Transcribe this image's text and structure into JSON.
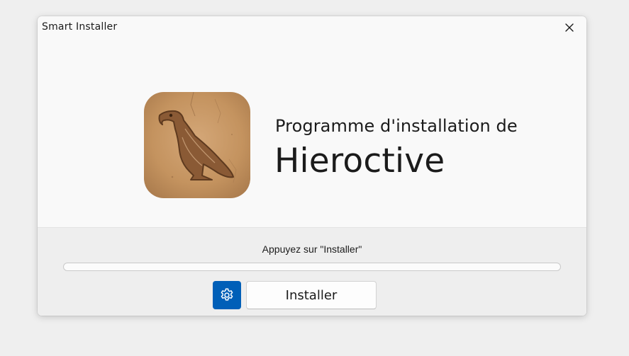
{
  "window": {
    "title": "Smart Installer"
  },
  "hero": {
    "subtitle": "Programme d'installation de",
    "app_name": "Hieroctive",
    "logo_icon": "falcon-hieroglyph-icon"
  },
  "footer": {
    "status": "Appuyez sur \"Installer\"",
    "progress_percent": 0,
    "settings_icon": "gear-icon",
    "install_label": "Installer"
  },
  "colors": {
    "accent": "#005fb8",
    "window_bg": "#f9f9f9",
    "footer_bg": "#eeeeee",
    "logo_sand": "#c79a6b"
  }
}
